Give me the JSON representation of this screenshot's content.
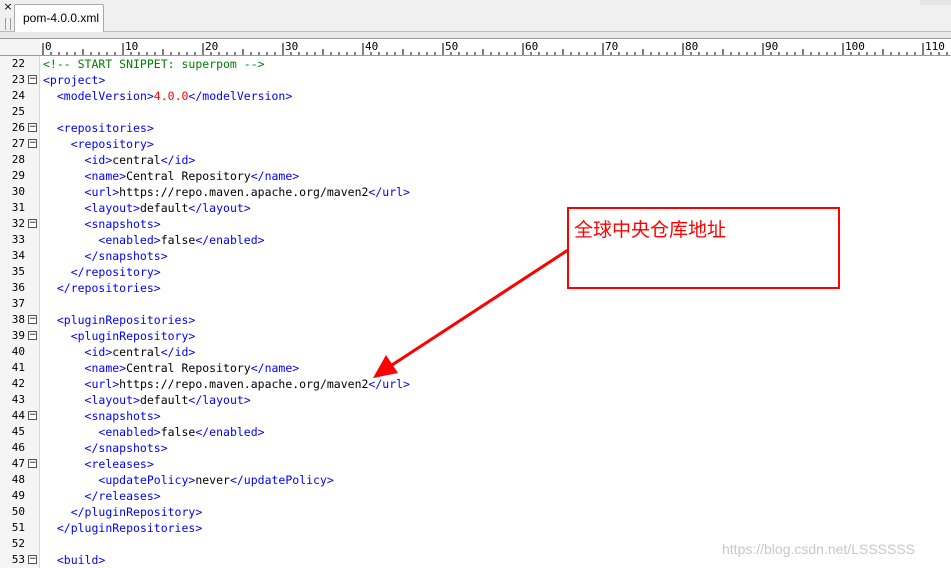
{
  "window": {
    "close_glyph": "×",
    "tab": {
      "label": "pom-4.0.0.xml"
    }
  },
  "ruler": {
    "labels": [
      "0",
      "10",
      "20",
      "30",
      "40",
      "50",
      "60",
      "70",
      "80",
      "90",
      "100",
      "110"
    ]
  },
  "colors": {
    "comment": "#008000",
    "tag": "#0000ff",
    "text": "#000000",
    "value": "#ff0000",
    "annotation": "#ff0000"
  },
  "editor": {
    "lines": [
      {
        "num": "22",
        "fold": "",
        "segments": [
          {
            "t": "<!-- START SNIPPET: superpom -->",
            "c": "comment"
          }
        ]
      },
      {
        "num": "23",
        "fold": "−",
        "segments": [
          {
            "t": "<project>",
            "c": "tag"
          }
        ]
      },
      {
        "num": "24",
        "fold": "",
        "segments": [
          {
            "t": "  ",
            "c": "text"
          },
          {
            "t": "<modelVersion>",
            "c": "tag"
          },
          {
            "t": "4.0.0",
            "c": "value"
          },
          {
            "t": "</modelVersion>",
            "c": "tag"
          }
        ]
      },
      {
        "num": "25",
        "fold": "",
        "segments": []
      },
      {
        "num": "26",
        "fold": "−",
        "segments": [
          {
            "t": "  ",
            "c": "text"
          },
          {
            "t": "<repositories>",
            "c": "tag"
          }
        ]
      },
      {
        "num": "27",
        "fold": "−",
        "segments": [
          {
            "t": "    ",
            "c": "text"
          },
          {
            "t": "<repository>",
            "c": "tag"
          }
        ]
      },
      {
        "num": "28",
        "fold": "",
        "segments": [
          {
            "t": "      ",
            "c": "text"
          },
          {
            "t": "<id>",
            "c": "tag"
          },
          {
            "t": "central",
            "c": "text"
          },
          {
            "t": "</id>",
            "c": "tag"
          }
        ]
      },
      {
        "num": "29",
        "fold": "",
        "segments": [
          {
            "t": "      ",
            "c": "text"
          },
          {
            "t": "<name>",
            "c": "tag"
          },
          {
            "t": "Central Repository",
            "c": "text"
          },
          {
            "t": "</name>",
            "c": "tag"
          }
        ]
      },
      {
        "num": "30",
        "fold": "",
        "segments": [
          {
            "t": "      ",
            "c": "text"
          },
          {
            "t": "<url>",
            "c": "tag"
          },
          {
            "t": "https://repo.maven.apache.org/maven2",
            "c": "text"
          },
          {
            "t": "</url>",
            "c": "tag"
          }
        ]
      },
      {
        "num": "31",
        "fold": "",
        "segments": [
          {
            "t": "      ",
            "c": "text"
          },
          {
            "t": "<layout>",
            "c": "tag"
          },
          {
            "t": "default",
            "c": "text"
          },
          {
            "t": "</layout>",
            "c": "tag"
          }
        ]
      },
      {
        "num": "32",
        "fold": "−",
        "segments": [
          {
            "t": "      ",
            "c": "text"
          },
          {
            "t": "<snapshots>",
            "c": "tag"
          }
        ]
      },
      {
        "num": "33",
        "fold": "",
        "segments": [
          {
            "t": "        ",
            "c": "text"
          },
          {
            "t": "<enabled>",
            "c": "tag"
          },
          {
            "t": "false",
            "c": "text"
          },
          {
            "t": "</enabled>",
            "c": "tag"
          }
        ]
      },
      {
        "num": "34",
        "fold": "",
        "segments": [
          {
            "t": "      ",
            "c": "text"
          },
          {
            "t": "</snapshots>",
            "c": "tag"
          }
        ]
      },
      {
        "num": "35",
        "fold": "",
        "segments": [
          {
            "t": "    ",
            "c": "text"
          },
          {
            "t": "</repository>",
            "c": "tag"
          }
        ]
      },
      {
        "num": "36",
        "fold": "",
        "segments": [
          {
            "t": "  ",
            "c": "text"
          },
          {
            "t": "</repositories>",
            "c": "tag"
          }
        ]
      },
      {
        "num": "37",
        "fold": "",
        "segments": []
      },
      {
        "num": "38",
        "fold": "−",
        "segments": [
          {
            "t": "  ",
            "c": "text"
          },
          {
            "t": "<pluginRepositories>",
            "c": "tag"
          }
        ]
      },
      {
        "num": "39",
        "fold": "−",
        "segments": [
          {
            "t": "    ",
            "c": "text"
          },
          {
            "t": "<pluginRepository>",
            "c": "tag"
          }
        ]
      },
      {
        "num": "40",
        "fold": "",
        "segments": [
          {
            "t": "      ",
            "c": "text"
          },
          {
            "t": "<id>",
            "c": "tag"
          },
          {
            "t": "central",
            "c": "text"
          },
          {
            "t": "</id>",
            "c": "tag"
          }
        ]
      },
      {
        "num": "41",
        "fold": "",
        "segments": [
          {
            "t": "      ",
            "c": "text"
          },
          {
            "t": "<name>",
            "c": "tag"
          },
          {
            "t": "Central Repository",
            "c": "text"
          },
          {
            "t": "</name>",
            "c": "tag"
          }
        ]
      },
      {
        "num": "42",
        "fold": "",
        "segments": [
          {
            "t": "      ",
            "c": "text"
          },
          {
            "t": "<url>",
            "c": "tag"
          },
          {
            "t": "https://repo.maven.apache.org/maven2",
            "c": "text"
          },
          {
            "t": "</url>",
            "c": "tag"
          }
        ]
      },
      {
        "num": "43",
        "fold": "",
        "segments": [
          {
            "t": "      ",
            "c": "text"
          },
          {
            "t": "<layout>",
            "c": "tag"
          },
          {
            "t": "default",
            "c": "text"
          },
          {
            "t": "</layout>",
            "c": "tag"
          }
        ]
      },
      {
        "num": "44",
        "fold": "−",
        "segments": [
          {
            "t": "      ",
            "c": "text"
          },
          {
            "t": "<snapshots>",
            "c": "tag"
          }
        ]
      },
      {
        "num": "45",
        "fold": "",
        "segments": [
          {
            "t": "        ",
            "c": "text"
          },
          {
            "t": "<enabled>",
            "c": "tag"
          },
          {
            "t": "false",
            "c": "text"
          },
          {
            "t": "</enabled>",
            "c": "tag"
          }
        ]
      },
      {
        "num": "46",
        "fold": "",
        "segments": [
          {
            "t": "      ",
            "c": "text"
          },
          {
            "t": "</snapshots>",
            "c": "tag"
          }
        ]
      },
      {
        "num": "47",
        "fold": "−",
        "segments": [
          {
            "t": "      ",
            "c": "text"
          },
          {
            "t": "<releases>",
            "c": "tag"
          }
        ]
      },
      {
        "num": "48",
        "fold": "",
        "segments": [
          {
            "t": "        ",
            "c": "text"
          },
          {
            "t": "<updatePolicy>",
            "c": "tag"
          },
          {
            "t": "never",
            "c": "text"
          },
          {
            "t": "</updatePolicy>",
            "c": "tag"
          }
        ]
      },
      {
        "num": "49",
        "fold": "",
        "segments": [
          {
            "t": "      ",
            "c": "text"
          },
          {
            "t": "</releases>",
            "c": "tag"
          }
        ]
      },
      {
        "num": "50",
        "fold": "",
        "segments": [
          {
            "t": "    ",
            "c": "text"
          },
          {
            "t": "</pluginRepository>",
            "c": "tag"
          }
        ]
      },
      {
        "num": "51",
        "fold": "",
        "segments": [
          {
            "t": "  ",
            "c": "text"
          },
          {
            "t": "</pluginRepositories>",
            "c": "tag"
          }
        ]
      },
      {
        "num": "52",
        "fold": "",
        "segments": []
      },
      {
        "num": "53",
        "fold": "−",
        "segments": [
          {
            "t": "  ",
            "c": "text"
          },
          {
            "t": "<build>",
            "c": "tag"
          }
        ]
      }
    ]
  },
  "annotation": {
    "text": "全球中央仓库地址"
  },
  "watermark": "https://blog.csdn.net/LSSSSSS"
}
